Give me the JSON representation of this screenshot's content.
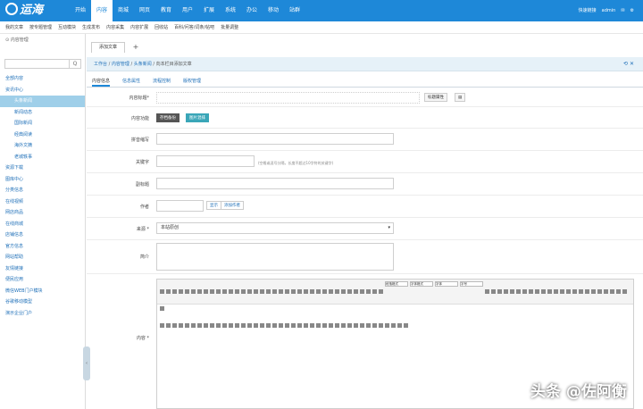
{
  "brand": "运海",
  "nav": [
    "开始",
    "内容",
    "商城",
    "网页",
    "教育",
    "用户",
    "扩展",
    "系统",
    "办公",
    "移动",
    "站群"
  ],
  "nav_active": 1,
  "top_right": {
    "quick": "快速链接",
    "user": "admin"
  },
  "subnav": [
    "我的文章",
    "按专题管理",
    "互动模块",
    "生成发布",
    "内容采集",
    "内容扩展",
    "回收站",
    "百科/问答/词条/帖吧",
    "批量调整"
  ],
  "sidebar": {
    "title": "内容管理",
    "search_btn": "Q",
    "items": [
      {
        "label": "全部内容",
        "level": 1
      },
      {
        "label": "资讯中心",
        "level": 1
      },
      {
        "label": "头条新闻",
        "level": 2,
        "selected": true
      },
      {
        "label": "新闻动态",
        "level": 2
      },
      {
        "label": "国际新闻",
        "level": 2
      },
      {
        "label": "经典阅读",
        "level": 2
      },
      {
        "label": "海外文摘",
        "level": 2
      },
      {
        "label": "老城轶事",
        "level": 2
      },
      {
        "label": "资源下载",
        "level": 1
      },
      {
        "label": "图库中心",
        "level": 1
      },
      {
        "label": "分类信息",
        "level": 1
      },
      {
        "label": "在线视频",
        "level": 1
      },
      {
        "label": "网店商品",
        "level": 1
      },
      {
        "label": "在线商城",
        "level": 1
      },
      {
        "label": "店铺信息",
        "level": 1
      },
      {
        "label": "官方信息",
        "level": 1
      },
      {
        "label": "网站帮助",
        "level": 1
      },
      {
        "label": "友情链接",
        "level": 1
      },
      {
        "label": "便民应用",
        "level": 1
      },
      {
        "label": "微信WEB门户模块",
        "level": 1
      },
      {
        "label": "谷歌移动模型",
        "level": 1
      },
      {
        "label": "演示企业门户",
        "level": 1
      }
    ]
  },
  "tab": {
    "label": "添加文章",
    "plus": "+"
  },
  "breadcrumb": {
    "root": "工作台",
    "p1": "内容管理",
    "p2": "头条新闻",
    "current": "向本栏目添加文章"
  },
  "form_tabs": [
    "内容信息",
    "信息属性",
    "流程控制",
    "版权管理"
  ],
  "form": {
    "title_label": "内容标题*",
    "title_btn": "标题属性",
    "func_label": "内容功能",
    "func_btns": [
      "存档备份",
      "图片混排"
    ],
    "sub_label": "拼音缩写",
    "kw_label": "关键字",
    "kw_hint": "(空格或逗号分隔，长度不超过10字符的关键字)",
    "subtitle_label": "副标题",
    "author_label": "作者",
    "author_btns": [
      "显示",
      "添加作者"
    ],
    "source_label": "来源 *",
    "source_value": "本站原创",
    "summary_label": "简介",
    "content_label": "内容 *",
    "editor_selects": [
      "段落格式",
      "字体格式",
      "字体",
      "字号"
    ]
  },
  "watermark": "头条 @佐阿衡"
}
